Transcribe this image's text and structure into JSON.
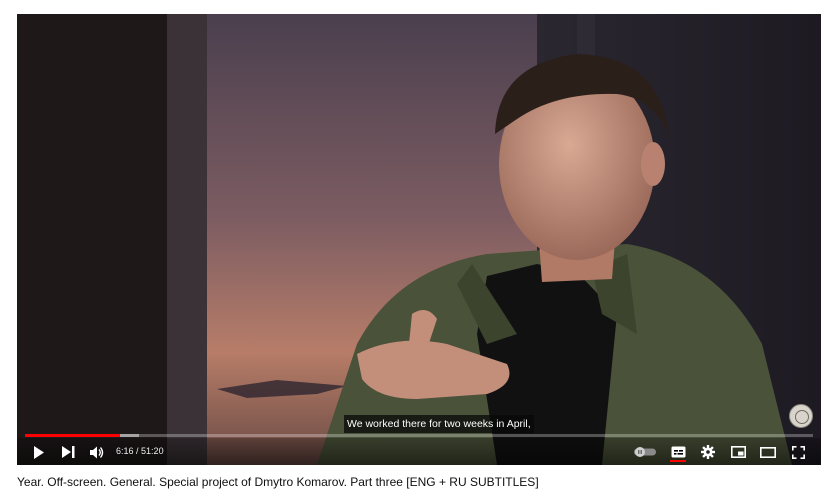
{
  "video": {
    "subtitle": "We worked there for two weeks in April,",
    "progress_fraction": 0.12,
    "buffered_fraction": 0.145
  },
  "controls": {
    "current_time": "6:16",
    "separator": " / ",
    "duration": "51:20",
    "icons": [
      "play-icon",
      "next-icon",
      "volume-icon",
      "autoplay-toggle-icon",
      "subtitles-icon",
      "settings-icon",
      "miniplayer-icon",
      "theater-icon",
      "fullscreen-icon"
    ]
  },
  "title": "Year. Off-screen. General. Special project of Dmytro Komarov. Part three [ENG + RU SUBTITLES]",
  "colors": {
    "progress": "#ff0000",
    "player_bg": "#1a1516"
  }
}
